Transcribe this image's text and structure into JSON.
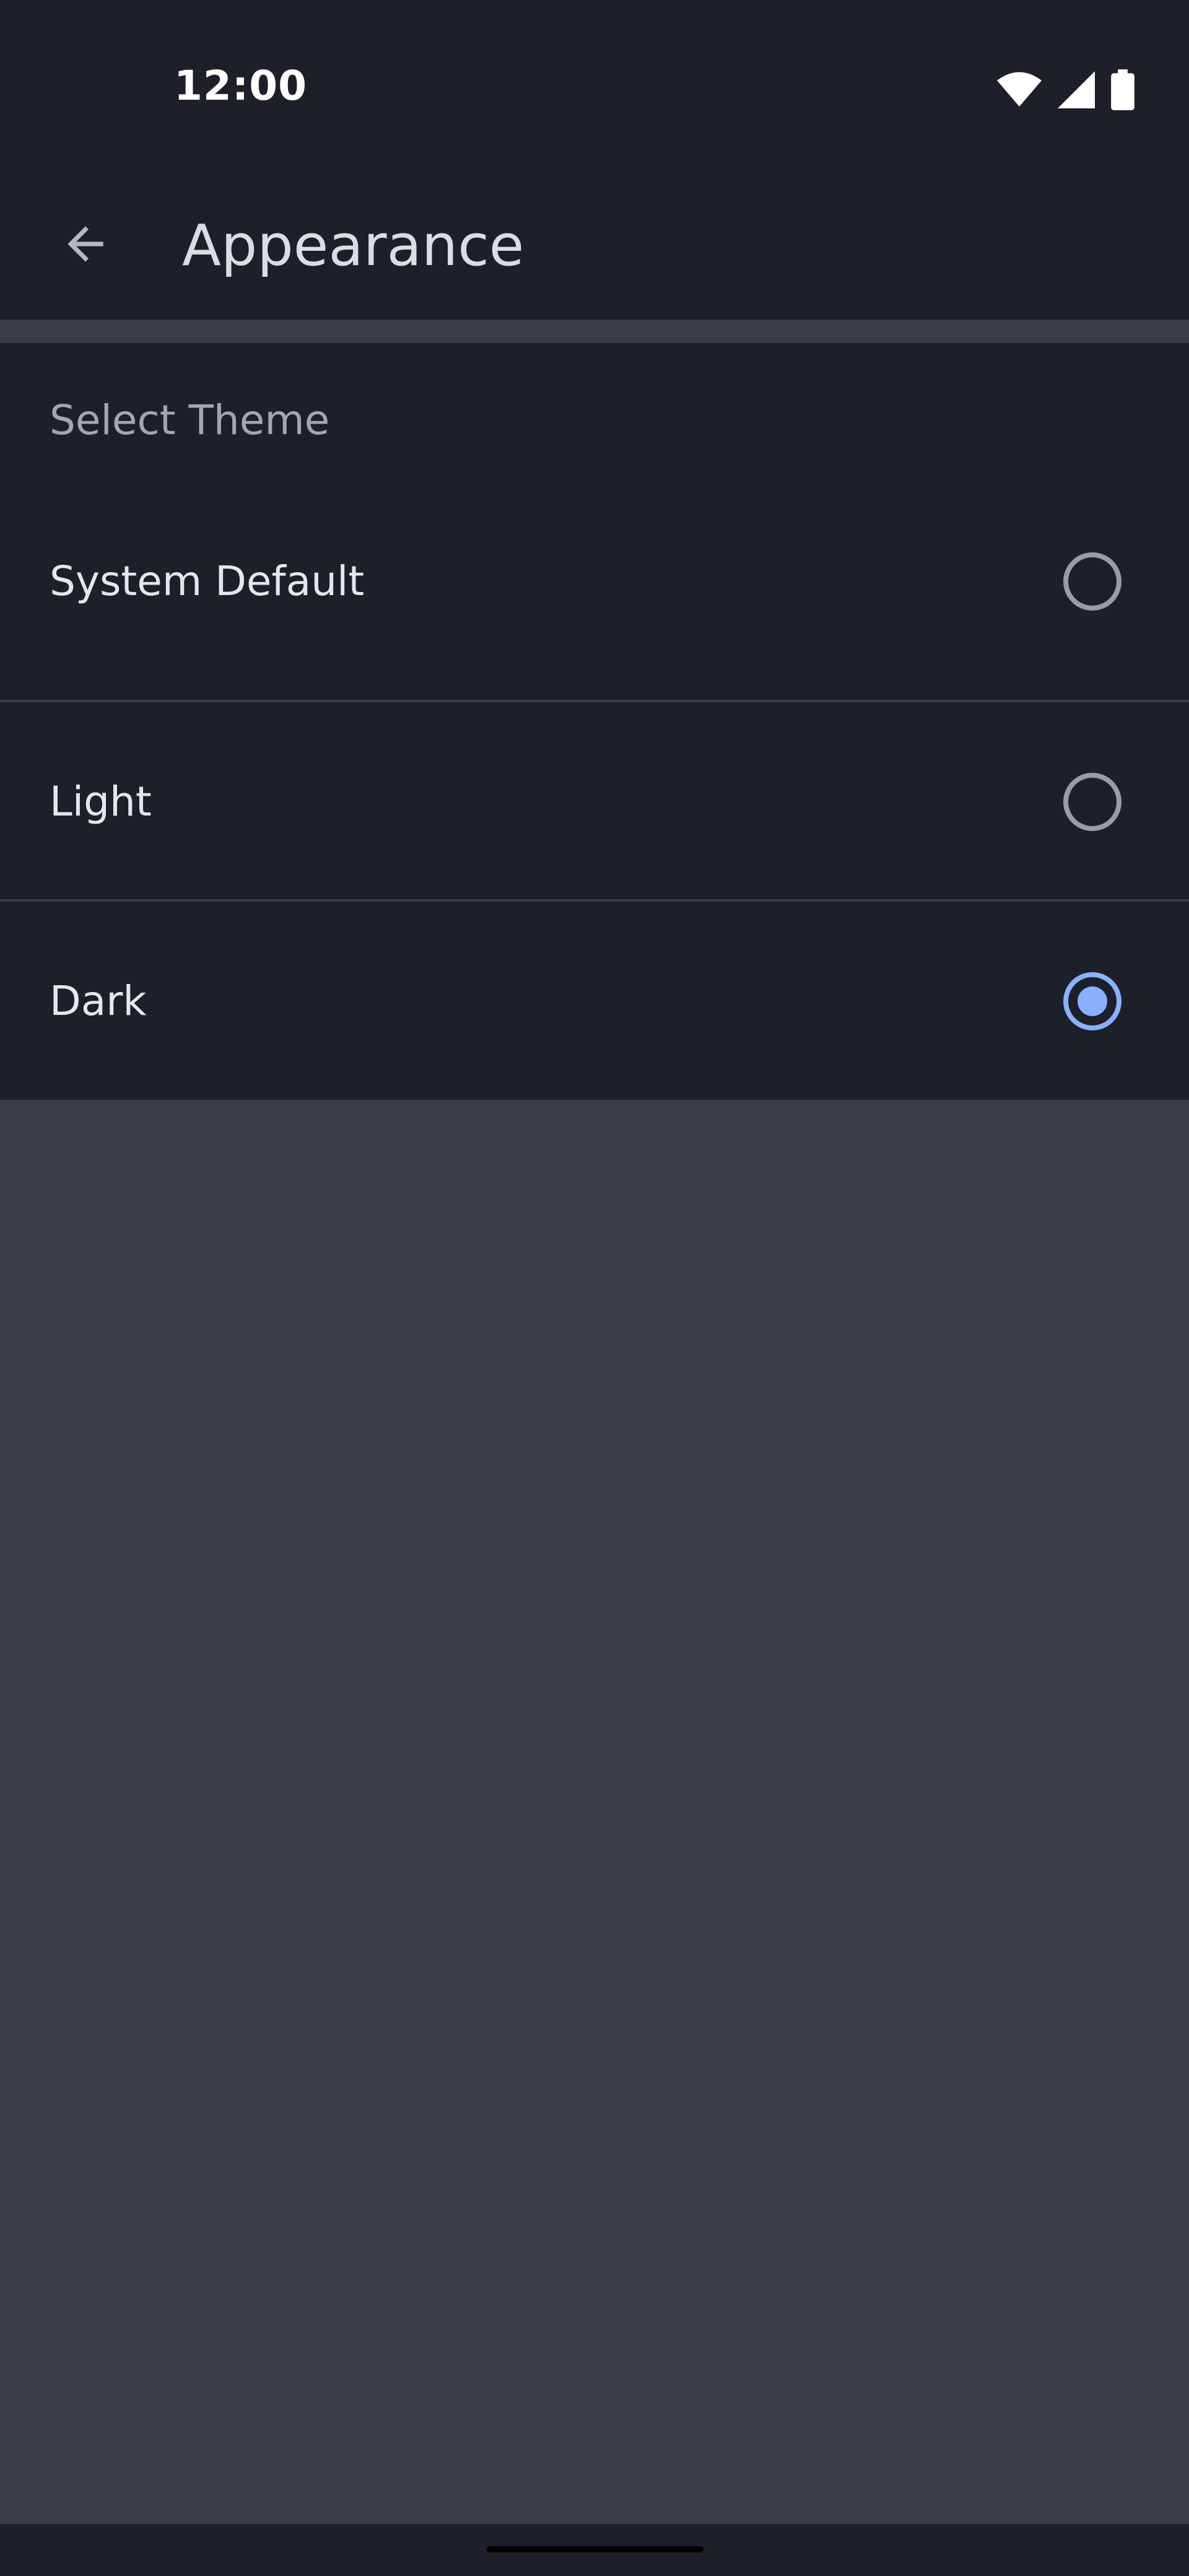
{
  "status_bar": {
    "time": "12:00",
    "icons": [
      "wifi-icon",
      "cellular-signal-icon",
      "battery-icon"
    ]
  },
  "app_bar": {
    "back_icon": "arrow-back-icon",
    "title": "Appearance"
  },
  "theme_section": {
    "header": "Select Theme",
    "options": [
      {
        "label": "System Default",
        "selected": false
      },
      {
        "label": "Light",
        "selected": false
      },
      {
        "label": "Dark",
        "selected": true
      }
    ]
  },
  "colors": {
    "background": "#1d1f29",
    "surface_gap": "#3a3c46",
    "accent": "#8ab0ff",
    "text_primary": "#e6e7ec",
    "text_secondary": "#a5a7b0"
  }
}
